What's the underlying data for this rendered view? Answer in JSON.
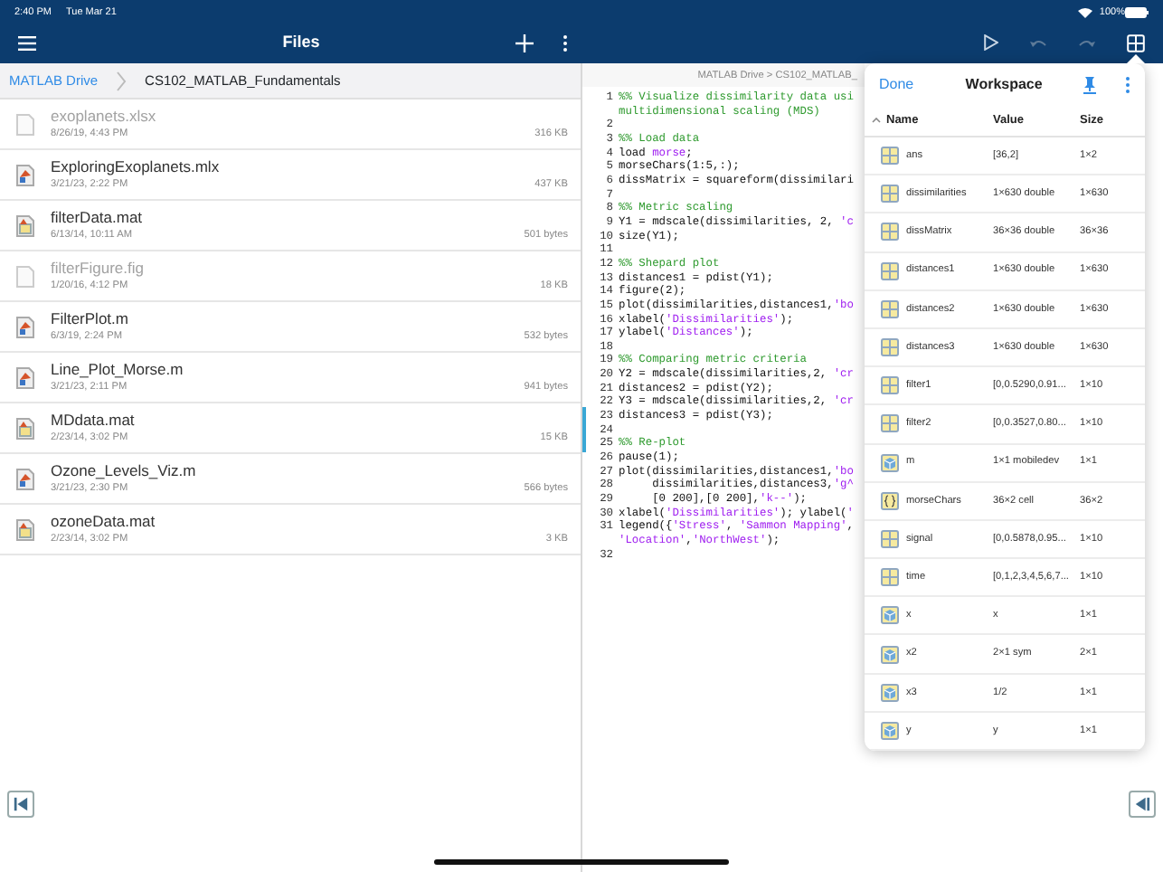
{
  "status_bar": {
    "time": "2:40 PM",
    "date": "Tue Mar 21",
    "battery": "100%"
  },
  "files_pane": {
    "title": "Files",
    "breadcrumb": {
      "root": "MATLAB Drive",
      "current": "CS102_MATLAB_Fundamentals"
    },
    "files": [
      {
        "name": "exoplanets.xlsx",
        "modified": "8/26/19, 4:43 PM",
        "size": "316 KB",
        "kind": "unsupported",
        "disabled": true
      },
      {
        "name": "ExploringExoplanets.mlx",
        "modified": "3/21/23, 2:22 PM",
        "size": "437 KB",
        "kind": "script",
        "disabled": false
      },
      {
        "name": "filterData.mat",
        "modified": "6/13/14, 10:11 AM",
        "size": "501 bytes",
        "kind": "data",
        "disabled": false
      },
      {
        "name": "filterFigure.fig",
        "modified": "1/20/16, 4:12 PM",
        "size": "18 KB",
        "kind": "unsupported",
        "disabled": true
      },
      {
        "name": "FilterPlot.m",
        "modified": "6/3/19, 2:24 PM",
        "size": "532 bytes",
        "kind": "script",
        "disabled": false
      },
      {
        "name": "Line_Plot_Morse.m",
        "modified": "3/21/23, 2:11 PM",
        "size": "941 bytes",
        "kind": "script",
        "disabled": false
      },
      {
        "name": "MDdata.mat",
        "modified": "2/23/14, 3:02 PM",
        "size": "15 KB",
        "kind": "data",
        "disabled": false
      },
      {
        "name": "Ozone_Levels_Viz.m",
        "modified": "3/21/23, 2:30 PM",
        "size": "566 bytes",
        "kind": "script",
        "disabled": false
      },
      {
        "name": "ozoneData.mat",
        "modified": "2/23/14, 3:02 PM",
        "size": "3 KB",
        "kind": "data",
        "disabled": false
      }
    ]
  },
  "editor": {
    "toolbar": [
      {
        "kind": "run",
        "disabled": false,
        "selected": false
      },
      {
        "kind": "undo",
        "disabled": true,
        "selected": false
      },
      {
        "kind": "redo",
        "disabled": true,
        "selected": false
      },
      {
        "kind": "workspace",
        "disabled": false,
        "selected": true
      }
    ],
    "path": "MATLAB Drive > CS102_MATLAB_",
    "lines": [
      {
        "number": "1",
        "rows": [
          [
            {
              "kind": "comment",
              "text": "%% Visualize dissimilarity data usi"
            }
          ],
          [
            {
              "kind": "comment",
              "text": "multidimensional scaling (MDS)"
            }
          ]
        ]
      },
      {
        "number": "2",
        "rows": [
          []
        ]
      },
      {
        "number": "3",
        "rows": [
          [
            {
              "kind": "comment",
              "text": "%% Load data"
            }
          ]
        ]
      },
      {
        "number": "4",
        "rows": [
          [
            {
              "kind": "code",
              "text": "load "
            },
            {
              "kind": "string",
              "text": "morse"
            },
            {
              "kind": "code",
              "text": ";"
            }
          ]
        ]
      },
      {
        "number": "5",
        "rows": [
          [
            {
              "kind": "code",
              "text": "morseChars(1:5,:);"
            }
          ]
        ]
      },
      {
        "number": "6",
        "rows": [
          [
            {
              "kind": "code",
              "text": "dissMatrix = squareform(dissimilari"
            }
          ]
        ]
      },
      {
        "number": "7",
        "rows": [
          []
        ]
      },
      {
        "number": "8",
        "rows": [
          [
            {
              "kind": "comment",
              "text": "%% Metric scaling"
            }
          ]
        ]
      },
      {
        "number": "9",
        "rows": [
          [
            {
              "kind": "code",
              "text": "Y1 = mdscale(dissimilarities, 2, "
            },
            {
              "kind": "string",
              "text": "'c"
            }
          ]
        ]
      },
      {
        "number": "10",
        "rows": [
          [
            {
              "kind": "code",
              "text": "size(Y1);"
            }
          ]
        ]
      },
      {
        "number": "11",
        "rows": [
          []
        ]
      },
      {
        "number": "12",
        "rows": [
          [
            {
              "kind": "comment",
              "text": "%% Shepard plot"
            }
          ]
        ]
      },
      {
        "number": "13",
        "rows": [
          [
            {
              "kind": "code",
              "text": "distances1 = pdist(Y1);"
            }
          ]
        ]
      },
      {
        "number": "14",
        "rows": [
          [
            {
              "kind": "code",
              "text": "figure(2);"
            }
          ]
        ]
      },
      {
        "number": "15",
        "rows": [
          [
            {
              "kind": "code",
              "text": "plot(dissimilarities,distances1,"
            },
            {
              "kind": "string",
              "text": "'bo"
            }
          ]
        ]
      },
      {
        "number": "16",
        "rows": [
          [
            {
              "kind": "code",
              "text": "xlabel("
            },
            {
              "kind": "string",
              "text": "'Dissimilarities'"
            },
            {
              "kind": "code",
              "text": ");"
            }
          ]
        ]
      },
      {
        "number": "17",
        "rows": [
          [
            {
              "kind": "code",
              "text": "ylabel("
            },
            {
              "kind": "string",
              "text": "'Distances'"
            },
            {
              "kind": "code",
              "text": ");"
            }
          ]
        ]
      },
      {
        "number": "18",
        "rows": [
          []
        ]
      },
      {
        "number": "19",
        "rows": [
          [
            {
              "kind": "comment",
              "text": "%% Comparing metric criteria"
            }
          ]
        ]
      },
      {
        "number": "20",
        "rows": [
          [
            {
              "kind": "code",
              "text": "Y2 = mdscale(dissimilarities,2, "
            },
            {
              "kind": "string",
              "text": "'cr"
            }
          ]
        ]
      },
      {
        "number": "21",
        "rows": [
          [
            {
              "kind": "code",
              "text": "distances2 = pdist(Y2);"
            }
          ]
        ]
      },
      {
        "number": "22",
        "rows": [
          [
            {
              "kind": "code",
              "text": "Y3 = mdscale(dissimilarities,2, "
            },
            {
              "kind": "string",
              "text": "'cr"
            }
          ]
        ]
      },
      {
        "number": "23",
        "rows": [
          [
            {
              "kind": "code",
              "text": "distances3 = pdist(Y3);"
            }
          ]
        ]
      },
      {
        "number": "24",
        "rows": [
          []
        ]
      },
      {
        "number": "25",
        "rows": [
          [
            {
              "kind": "comment",
              "text": "%% Re-plot"
            }
          ]
        ]
      },
      {
        "number": "26",
        "rows": [
          [
            {
              "kind": "code",
              "text": "pause(1);"
            }
          ]
        ]
      },
      {
        "number": "27",
        "rows": [
          [
            {
              "kind": "code",
              "text": "plot(dissimilarities,distances1,"
            },
            {
              "kind": "string",
              "text": "'bo"
            }
          ]
        ]
      },
      {
        "number": "28",
        "rows": [
          [
            {
              "kind": "code",
              "text": "     dissimilarities,distances3,"
            },
            {
              "kind": "string",
              "text": "'g^"
            }
          ]
        ]
      },
      {
        "number": "29",
        "rows": [
          [
            {
              "kind": "code",
              "text": "     [0 200],[0 200],"
            },
            {
              "kind": "string",
              "text": "'k--'"
            },
            {
              "kind": "code",
              "text": ");"
            }
          ]
        ]
      },
      {
        "number": "30",
        "rows": [
          [
            {
              "kind": "code",
              "text": "xlabel("
            },
            {
              "kind": "string",
              "text": "'Dissimilarities'"
            },
            {
              "kind": "code",
              "text": "); ylabel("
            },
            {
              "kind": "string",
              "text": "'"
            }
          ]
        ]
      },
      {
        "number": "31",
        "rows": [
          [
            {
              "kind": "code",
              "text": "legend({"
            },
            {
              "kind": "string",
              "text": "'Stress'"
            },
            {
              "kind": "code",
              "text": ", "
            },
            {
              "kind": "string",
              "text": "'Sammon Mapping'"
            },
            {
              "kind": "code",
              "text": ","
            }
          ],
          [
            {
              "kind": "string",
              "text": "'Location'"
            },
            {
              "kind": "code",
              "text": ","
            },
            {
              "kind": "string",
              "text": "'NorthWest'"
            },
            {
              "kind": "code",
              "text": ");"
            }
          ]
        ]
      },
      {
        "number": "32",
        "rows": [
          []
        ]
      }
    ]
  },
  "workspace": {
    "done": "Done",
    "title": "Workspace",
    "columns": [
      "Name",
      "Value",
      "Size"
    ],
    "variables": [
      {
        "name": "ans",
        "value": "[36,2]",
        "size": "1×2",
        "kind": "matrix"
      },
      {
        "name": "dissimilarities",
        "value": "1×630 double",
        "size": "1×630",
        "kind": "matrix"
      },
      {
        "name": "dissMatrix",
        "value": "36×36 double",
        "size": "36×36",
        "kind": "matrix"
      },
      {
        "name": "distances1",
        "value": "1×630 double",
        "size": "1×630",
        "kind": "matrix"
      },
      {
        "name": "distances2",
        "value": "1×630 double",
        "size": "1×630",
        "kind": "matrix"
      },
      {
        "name": "distances3",
        "value": "1×630 double",
        "size": "1×630",
        "kind": "matrix"
      },
      {
        "name": "filter1",
        "value": "[0,0.5290,0.91...",
        "size": "1×10",
        "kind": "matrix"
      },
      {
        "name": "filter2",
        "value": "[0,0.3527,0.80...",
        "size": "1×10",
        "kind": "matrix"
      },
      {
        "name": "m",
        "value": "1×1 mobiledev",
        "size": "1×1",
        "kind": "object"
      },
      {
        "name": "morseChars",
        "value": "36×2 cell",
        "size": "36×2",
        "kind": "cell"
      },
      {
        "name": "signal",
        "value": "[0,0.5878,0.95...",
        "size": "1×10",
        "kind": "matrix"
      },
      {
        "name": "time",
        "value": "[0,1,2,3,4,5,6,7...",
        "size": "1×10",
        "kind": "matrix"
      },
      {
        "name": "x",
        "value": "x",
        "size": "1×1",
        "kind": "object"
      },
      {
        "name": "x2",
        "value": "2×1 sym",
        "size": "2×1",
        "kind": "object"
      },
      {
        "name": "x3",
        "value": "1/2",
        "size": "1×1",
        "kind": "object"
      },
      {
        "name": "y",
        "value": "y",
        "size": "1×1",
        "kind": "object"
      }
    ]
  }
}
